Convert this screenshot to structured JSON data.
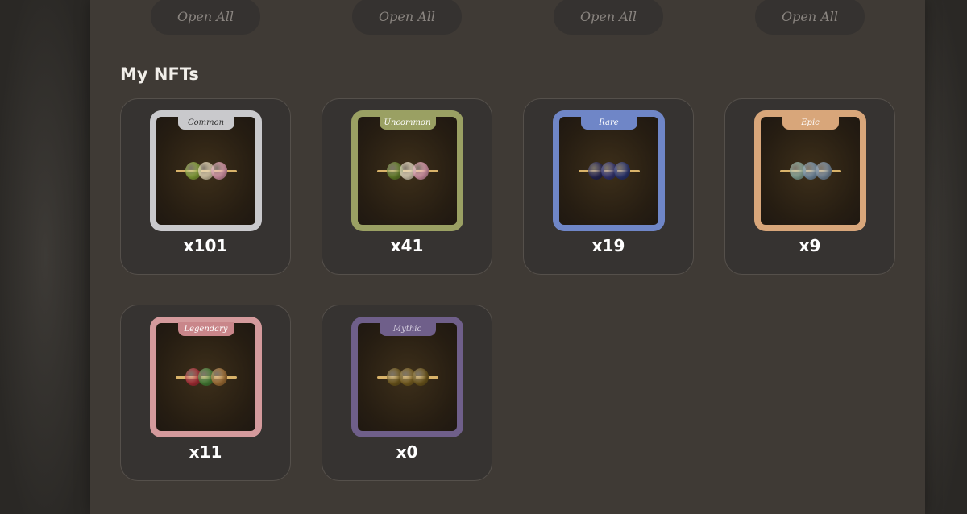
{
  "open_buttons": [
    "Open All",
    "Open All",
    "Open All",
    "Open All"
  ],
  "section_title": "My NFTs",
  "nfts": [
    {
      "rarity": "Common",
      "count": "x101",
      "frame_color": "#c9c9cc",
      "tag_color": "#c9c9cc",
      "tag_text_color": "#333333",
      "balls": [
        "#8fae3c",
        "#e9d9b5",
        "#e7a0b4"
      ]
    },
    {
      "rarity": "Uncommon",
      "count": "x41",
      "frame_color": "#9aa063",
      "tag_color": "#9aa063",
      "tag_text_color": "#ffffff",
      "balls": [
        "#6c8a2d",
        "#e9dcc0",
        "#e7a0b4"
      ]
    },
    {
      "rarity": "Rare",
      "count": "x19",
      "frame_color": "#6f86c7",
      "tag_color": "#6f86c7",
      "tag_text_color": "#ffffff",
      "balls": [
        "#2b2a5a",
        "#3a3a7a",
        "#2f3a7a"
      ]
    },
    {
      "rarity": "Epic",
      "count": "x9",
      "frame_color": "#d8a67a",
      "tag_color": "#d8a67a",
      "tag_text_color": "#ffffff",
      "balls": [
        "#8fb0a0",
        "#7e99b0",
        "#7f93a7"
      ]
    },
    {
      "rarity": "Legendary",
      "count": "x11",
      "frame_color": "#d49a9c",
      "tag_color": "#c9868a",
      "tag_text_color": "#ffffff",
      "balls": [
        "#b8323a",
        "#4d8a3a",
        "#b07a3a"
      ]
    },
    {
      "rarity": "Mythic",
      "count": "x0",
      "frame_color": "#6f5f8a",
      "tag_color": "#6f5f8a",
      "tag_text_color": "#d7d0e0",
      "balls": [
        "#7a6120",
        "#866a25",
        "#7a6120"
      ]
    }
  ]
}
